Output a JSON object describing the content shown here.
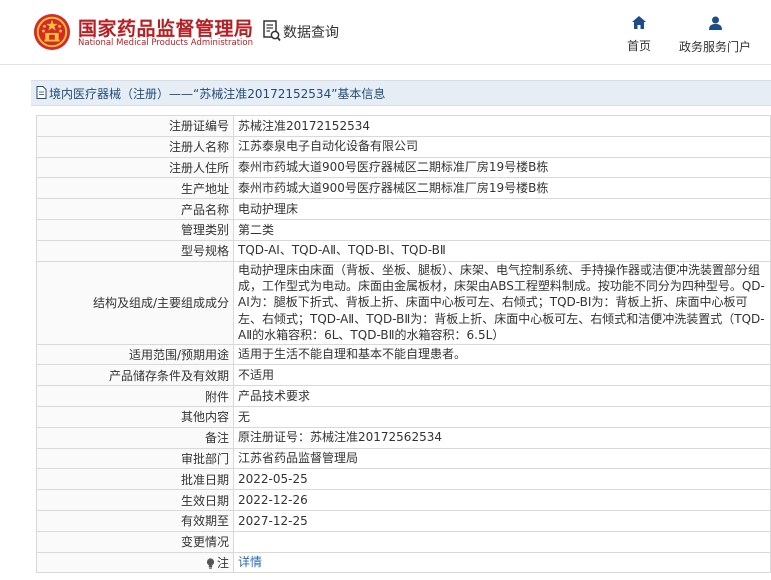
{
  "header": {
    "logo_cn": "国家药品监督管理局",
    "logo_en": "National Medical Products Administration",
    "query_label": "数据查询",
    "nav": [
      {
        "label": "首页",
        "icon": "home-icon"
      },
      {
        "label": "政务服务门户",
        "icon": "user-icon"
      }
    ]
  },
  "title_bar": {
    "text": "境内医疗器械（注册）——“苏械注准20172152534”基本信息",
    "icon": "document-icon"
  },
  "rows": [
    {
      "label": "注册证编号",
      "value": "苏械注准20172152534"
    },
    {
      "label": "注册人名称",
      "value": "江苏泰泉电子自动化设备有限公司"
    },
    {
      "label": "注册人住所",
      "value": "泰州市药城大道900号医疗器械区二期标准厂房19号楼B栋"
    },
    {
      "label": "生产地址",
      "value": "泰州市药城大道900号医疗器械区二期标准厂房19号楼B栋"
    },
    {
      "label": "产品名称",
      "value": "电动护理床"
    },
    {
      "label": "管理类别",
      "value": "第二类"
    },
    {
      "label": "型号规格",
      "value": "TQD-AⅠ、TQD-AⅡ、TQD-BⅠ、TQD-BⅡ"
    },
    {
      "label": "结构及组成/主要组成成分",
      "value": "电动护理床由床面（背板、坐板、腿板）、床架、电气控制系统、手持操作器或洁便冲洗装置部分组成，工作型式为电动。床面由金属板材，床架由ABS工程塑料制成。按功能不同分为四种型号。QD-AⅠ为：腿板下折式、背板上折、床面中心板可左、右倾式；TQD-BⅠ为：背板上折、床面中心板可左、右倾式；TQD-AⅡ、TQD-BⅡ为：背板上折、床面中心板可左、右倾式和洁便冲洗装置式（TQD-AⅡ的水箱容积：6L、TQD-BⅡ的水箱容积：6.5L）"
    },
    {
      "label": "适用范围/预期用途",
      "value": "适用于生活不能自理和基本不能自理患者。"
    },
    {
      "label": "产品储存条件及有效期",
      "value": "不适用"
    },
    {
      "label": "附件",
      "value": "产品技术要求"
    },
    {
      "label": "其他内容",
      "value": "无"
    },
    {
      "label": "备注",
      "value": "原注册证号：苏械注准20172562534"
    },
    {
      "label": "审批部门",
      "value": "江苏省药品监督管理局"
    },
    {
      "label": "批准日期",
      "value": "2022-05-25"
    },
    {
      "label": "生效日期",
      "value": "2022-12-26"
    },
    {
      "label": "有效期至",
      "value": "2027-12-25"
    },
    {
      "label": "变更情况",
      "value": ""
    },
    {
      "label": "注",
      "value": "详情",
      "icon": "lightbulb-icon"
    }
  ],
  "colors": {
    "brand_red": "#b52024",
    "title_blue": "#1f4d7a",
    "link_blue": "#2a6bb5"
  }
}
